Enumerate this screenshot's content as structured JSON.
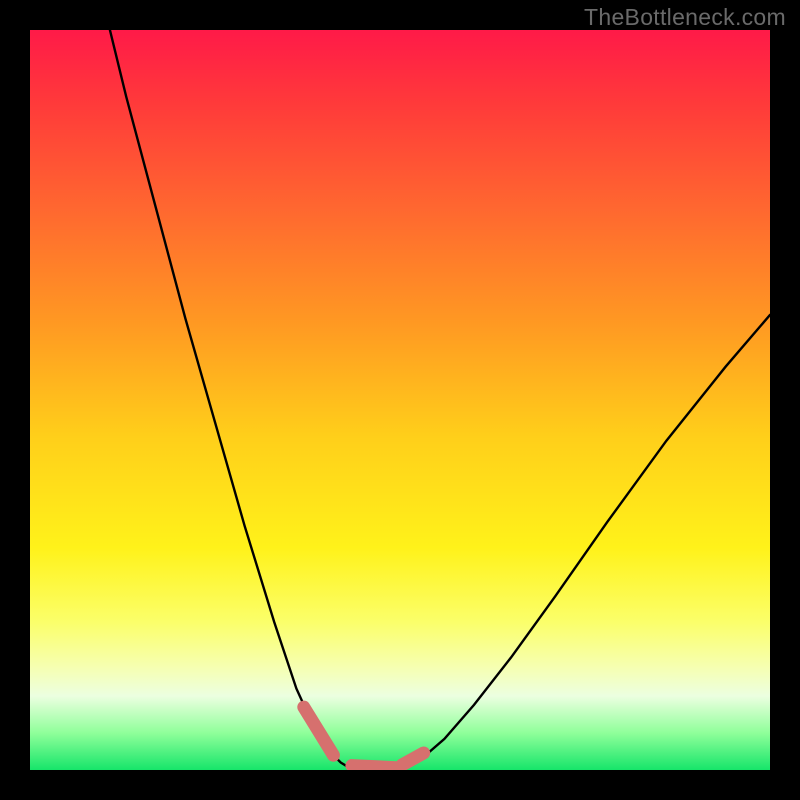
{
  "watermark": {
    "text": "TheBottleneck.com"
  },
  "colors": {
    "curve_stroke": "#000000",
    "marker_stroke": "#d6706e",
    "gradient_stops": [
      "#ff1a48",
      "#ff3a3a",
      "#ff6a2f",
      "#ff9a22",
      "#ffcf1a",
      "#fff21a",
      "#fbff6a",
      "#f6ffb0",
      "#ecffe0",
      "#8fff9a",
      "#16e56a"
    ]
  },
  "chart_data": {
    "type": "line",
    "title": "",
    "xlabel": "",
    "ylabel": "",
    "xlim": [
      0,
      100
    ],
    "ylim": [
      0,
      100
    ],
    "grid": false,
    "series": [
      {
        "name": "left-branch",
        "x": [
          10.8,
          13,
          17,
          21,
          25,
          29,
          33,
          36,
          38.5,
          40.5,
          42,
          43
        ],
        "y": [
          100,
          91,
          76,
          61,
          47,
          33,
          20,
          11,
          5.5,
          2.5,
          1.0,
          0.4
        ]
      },
      {
        "name": "right-branch",
        "x": [
          51,
          53,
          56,
          60,
          65,
          71,
          78,
          86,
          94,
          100
        ],
        "y": [
          0.6,
          1.6,
          4.2,
          8.8,
          15.2,
          23.5,
          33.5,
          44.5,
          54.5,
          61.5
        ]
      },
      {
        "name": "valley",
        "x": [
          43,
          44,
          45.5,
          47,
          48.5,
          50,
          51
        ],
        "y": [
          0.4,
          0.15,
          0.04,
          0.0,
          0.04,
          0.25,
          0.6
        ]
      }
    ],
    "markers": [
      {
        "name": "left-slope",
        "x": [
          37.0,
          41.0
        ],
        "y": [
          8.5,
          2.0
        ]
      },
      {
        "name": "floor",
        "x": [
          43.5,
          49.5
        ],
        "y": [
          0.6,
          0.3
        ]
      },
      {
        "name": "right-slope",
        "x": [
          50.3,
          53.2
        ],
        "y": [
          0.7,
          2.3
        ]
      }
    ]
  }
}
